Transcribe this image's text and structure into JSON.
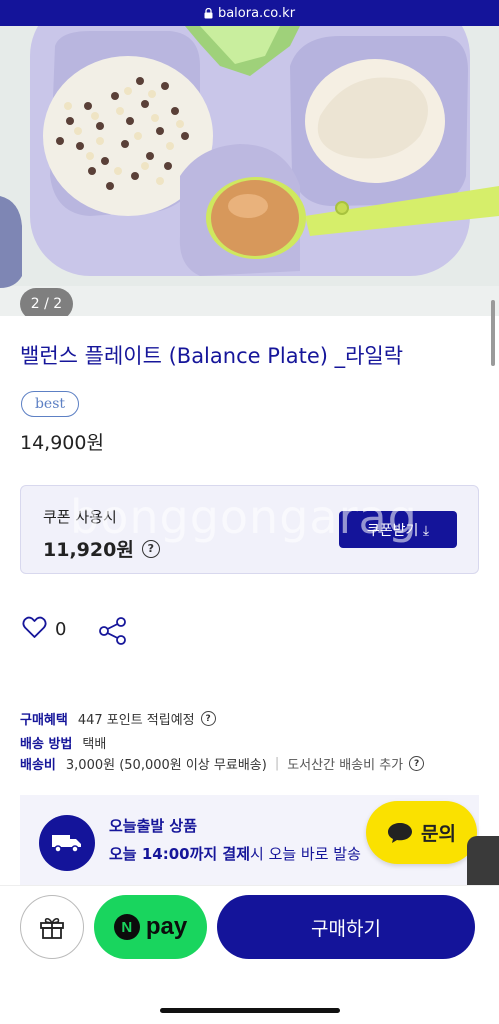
{
  "browser": {
    "url": "balora.co.kr"
  },
  "gallery": {
    "counter": "2 / 2"
  },
  "product": {
    "title": "밸런스 플레이트 (Balance Plate) _라일락",
    "badge": "best",
    "price": "14,900원"
  },
  "coupon": {
    "label": "쿠폰 사용시",
    "price": "11,920원",
    "button_label": "쿠폰받기 ⤓",
    "watermark": "bonggongarag"
  },
  "social": {
    "like_count": "0"
  },
  "info": {
    "benefit_key": "구매혜택",
    "benefit_value": "447 포인트 적립예정",
    "method_key": "배송 방법",
    "method_value": "택배",
    "fee_key": "배송비",
    "fee_value": "3,000원 (50,000원 이상 무료배송)",
    "fee_extra": "도서산간 배송비 추가"
  },
  "today_shipping": {
    "title": "오늘출발 상품",
    "desc_bold": "오늘 14:00까지 결제",
    "desc_rest": "시 오늘 바로 발송"
  },
  "chat": {
    "label": "문의"
  },
  "bottom": {
    "npay_letter": "N",
    "npay_label": "pay",
    "buy_label": "구매하기"
  },
  "colors": {
    "brand": "#14149a",
    "npay": "#19d55e",
    "kakao": "#fae100"
  }
}
